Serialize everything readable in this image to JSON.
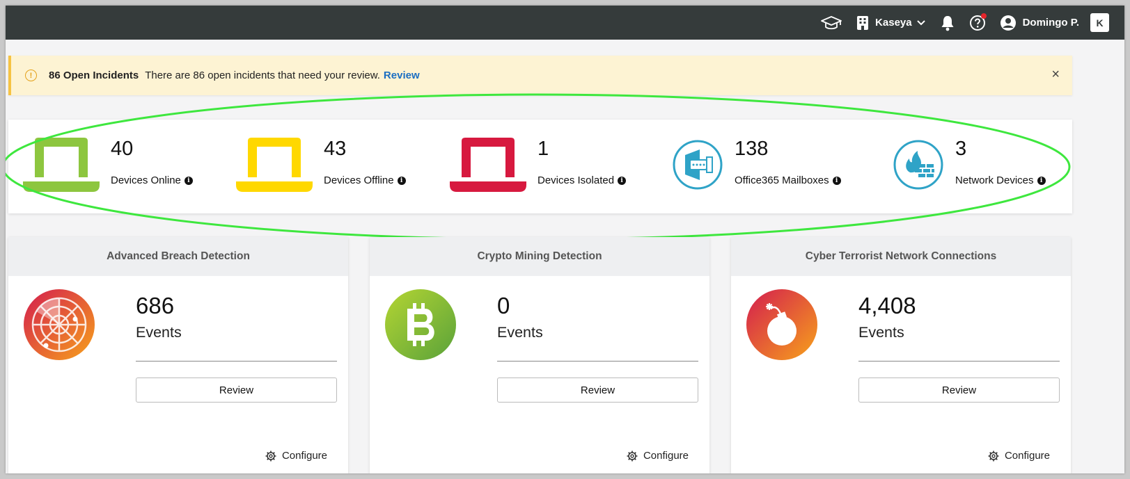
{
  "topbar": {
    "org_name": "Kaseya",
    "user_name": "Domingo P.",
    "logo_text": "K",
    "icons": [
      "graduation-cap-icon",
      "building-icon",
      "chevron-down-icon",
      "bell-icon",
      "help-icon",
      "user-circle-icon"
    ]
  },
  "alert": {
    "title": "86 Open Incidents",
    "message": "There are 86 open incidents that need your review.",
    "link": "Review",
    "close": "×",
    "warn_glyph": "!"
  },
  "stats": [
    {
      "value": "40",
      "label": "Devices Online",
      "icon": "laptop-icon",
      "color": "#8dc63f"
    },
    {
      "value": "43",
      "label": "Devices Offline",
      "icon": "laptop-icon",
      "color": "#ffd800"
    },
    {
      "value": "1",
      "label": "Devices Isolated",
      "icon": "laptop-icon",
      "color": "#d7193f"
    },
    {
      "value": "138",
      "label": "Office365 Mailboxes",
      "icon": "office365-mailbox-icon",
      "color": "#2fa3c7"
    },
    {
      "value": "3",
      "label": "Network Devices",
      "icon": "firewall-icon",
      "color": "#2fa3c7"
    }
  ],
  "info_glyph": "i",
  "cards": [
    {
      "title": "Advanced Breach Detection",
      "value": "686",
      "unit": "Events",
      "button": "Review",
      "configure": "Configure",
      "icon": "radar-icon"
    },
    {
      "title": "Crypto Mining Detection",
      "value": "0",
      "unit": "Events",
      "button": "Review",
      "configure": "Configure",
      "icon": "bitcoin-icon"
    },
    {
      "title": "Cyber Terrorist Network Connections",
      "value": "4,408",
      "unit": "Events",
      "button": "Review",
      "configure": "Configure",
      "icon": "bomb-icon"
    }
  ],
  "colors": {
    "topbar_bg": "#353b3b",
    "alert_bg": "#fdf3d3",
    "alert_border": "#f6c343",
    "link": "#1b6ec2",
    "highlight": "#3ee73e"
  }
}
